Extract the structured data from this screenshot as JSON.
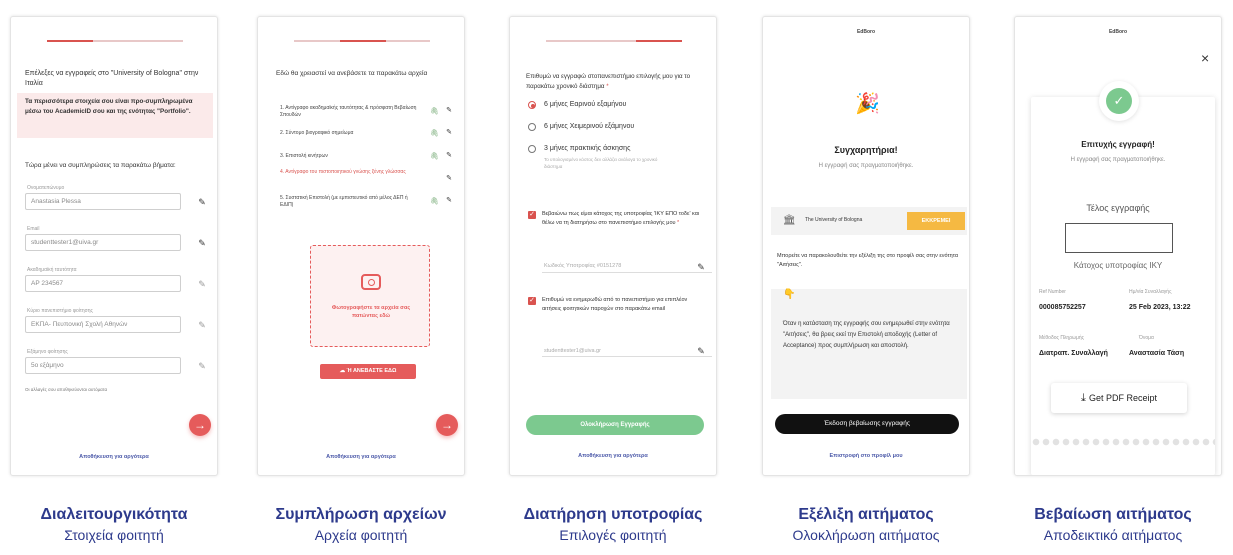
{
  "screens": [
    {
      "intro": "Επέλεξες να εγγραφείς στο \"University of Bologna\" στην Ιταλία",
      "notice": "Τα περισσότερα στοιχεία σου είναι προ-συμπληρωμένα μέσω του AcademicID σου και της ενότητας \"Portfolio\".",
      "prompt": "Τώρα μένει να συμπληρώσεις τα παρακάτω βήματα:",
      "fields": [
        {
          "label": "Ονοματεπώνυμο",
          "value": "Anastasia Plessa"
        },
        {
          "label": "Email",
          "value": "studenttester1@uiva.gr"
        },
        {
          "label": "Ακαδημαϊκή ταυτότητα",
          "value": "AP 234567"
        },
        {
          "label": "Κύριο πανεπιστήμιο φοίτησης",
          "value": "ΕΚΠΑ- Πευπονική Σχολή Αθηνών"
        },
        {
          "label": "Εξάμηνο φοίτησης",
          "value": "5ο εξάμηνο"
        }
      ],
      "footnote": "Οι αλλαγές σου αποθηκεύονται αυτόματα",
      "save": "Αποθήκευση για αργότερα"
    },
    {
      "intro": "Εδώ θα χρειαστεί να ανεβάσετε τα παρακάτω αρχεία",
      "files": [
        "1. Αντίγραφο ακαδημαϊκής ταυτότητας & πρόσφατη Βεβαίωση Σπουδών",
        "2. Σύντομο βιογραφικό σημείωμα",
        "3. Επιστολή κινήτρων",
        "4. Αντίγραφο του πιστοποιητικού γνώσης ξένης γλώσσας",
        "5. Συστατική Επιστολή (με εμπιστευτικό από μέλος ΔΕΠ ή ΕΔΙΠ)"
      ],
      "photo": "Φωτογραφήστε τα αρχεία σας πατώντας εδώ",
      "upload": "Ή ΑΝΕΒΑΣΤΕ ΕΔΩ",
      "save": "Αποθήκευση για αργότερα"
    },
    {
      "intro": "Επιθυμώ να εγγραφώ στοπανεπιστήμιο επιλογής μου για το παρακάτω χρονικό διάστημα",
      "options": [
        "6 μήνες Εαρινού εξαμήνου",
        "6 μήνες Χειμερινού εξάμηνου",
        "3 μήνες πρακτικής άσκησης"
      ],
      "option_hint": "Το υπολογισμένο κόστος δεν αλλάζει ανάλογα το χρονικό διάστημα",
      "consent1": "Βεβαιώνω πως είμαι κάτοχος της υποτροφίας 'ΙΚΥ ΕΠΟ τοδε' και θέλω να τη διατηρήσω στο πανεπιστήμιο επιλογής μου",
      "scholar_code": "Κωδικός Υποτροφίας #0151278",
      "consent2": "Επιθυμώ να ενημερωθώ από το πανεπιστήμιο για επιπλέον αιτήσεις φοιτητικών παροχών στο παρακάτω email",
      "email": "studenttester1@uiva.gr",
      "complete": "Ολοκλήρωση Εγγραφής",
      "save": "Αποθήκευση για αργότερα"
    },
    {
      "logo": "EdBoro",
      "title": "Συγχαρητήρια!",
      "subtitle": "Η εγγραφή σας πραγματοποιήθηκε.",
      "university": "The University of Bologna",
      "status": "ΕΚΚΡΕΜΕΙ",
      "track": "Μπορείτε να παρακολουθείτε την εξέλιξη της στο προφίλ σας στην ενότητα \"Αιτήσεις\".",
      "info": "Όταν η κατάσταση της εγγραφής σου ενημερωθεί στην ενότητα \"Αιτήσεις\", θα βρεις εκεί την Επιστολή αποδοχής (Letter of Acceptance) προς συμπλήρωση και αποστολή.",
      "cta": "Έκδοση βεβαίωσης εγγραφής",
      "back": "Επιστροφή στο προφίλ μου"
    },
    {
      "logo": "EdBoro",
      "title": "Επιτυχής εγγραφή!",
      "subtitle": "Η εγγραφή σας πραγματοποιήθηκε.",
      "fee_title": "Τέλος εγγραφής",
      "holder": "Κάτοχος υποτροφίας ΙΚΥ",
      "ref_label": "Ref Number",
      "ref_value": "000085752257",
      "date_label": "Ημ/νία Συναλλαγής",
      "date_value": "25 Feb 2023, 13:22",
      "method_label": "Μέθοδος Πληρωμής",
      "method_value": "Διατραπ. Συναλλαγή",
      "name_label": "Όνομα",
      "name_value": "Αναστασία Τάση",
      "pdf": "Get PDF Receipt"
    }
  ],
  "captions": [
    {
      "title": "Διαλειτουργικότητα",
      "sub": "Στοιχεία φοιτητή"
    },
    {
      "title": "Συμπλήρωση αρχείων",
      "sub": "Αρχεία φοιτητή"
    },
    {
      "title": "Διατήρηση υποτροφίας",
      "sub": "Επιλογές φοιτητή"
    },
    {
      "title": "Εξέλιξη αιτήματος",
      "sub": "Ολοκλήρωση αιτήματος"
    },
    {
      "title": "Βεβαίωση αιτήματος",
      "sub": "Αποδεικτικό αιτήματος"
    }
  ],
  "colors": {
    "accent": "#e55b5b",
    "caption": "#2d3a8c",
    "green": "#7cc98f",
    "dark": "#111111",
    "badge": "#f5b942"
  }
}
